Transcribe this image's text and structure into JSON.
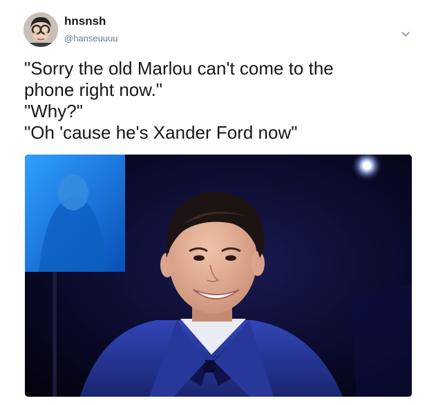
{
  "user": {
    "display_name": "hnsnsh",
    "handle": "@hanseuuuu",
    "avatar_icon": "profile-avatar"
  },
  "menu": {
    "icon": "chevron-down-icon"
  },
  "tweet": {
    "lines": [
      "\"Sorry the old Marlou can't come to the",
      "phone right now.\"",
      "\"Why?\"",
      "\"Oh 'cause he's Xander Ford now\""
    ]
  },
  "media": {
    "type": "photo"
  },
  "colors": {
    "text": "#14171a",
    "secondary": "#657786",
    "background": "#ffffff"
  }
}
